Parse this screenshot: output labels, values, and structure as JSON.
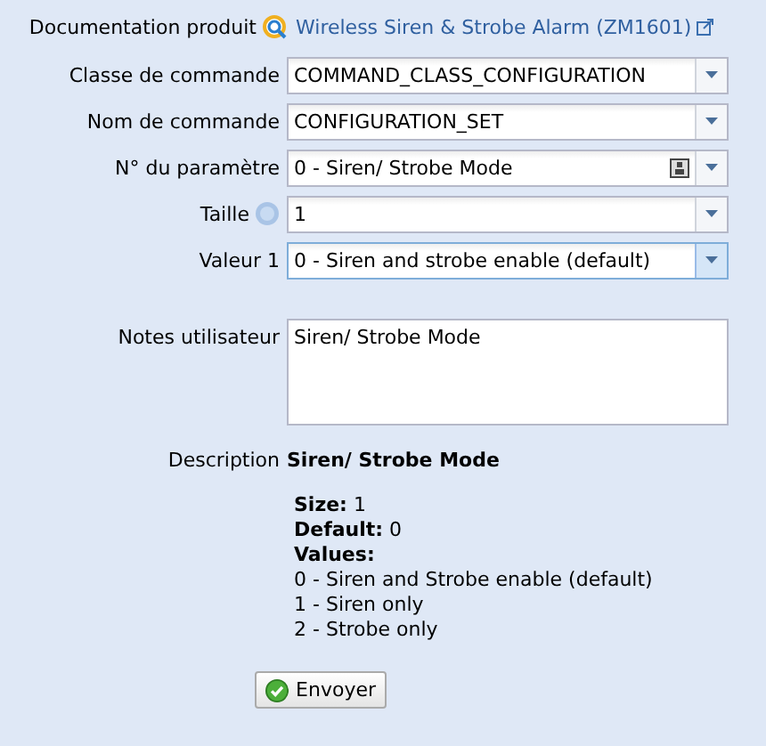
{
  "product_doc": {
    "label": "Documentation produit",
    "link": "Wireless Siren & Strobe Alarm (ZM1601)"
  },
  "fields": [
    {
      "label": "Classe de commande",
      "value": "COMMAND_CLASS_CONFIGURATION",
      "focused": false,
      "help": false,
      "picker": false
    },
    {
      "label": "Nom de commande",
      "value": "CONFIGURATION_SET",
      "focused": false,
      "help": false,
      "picker": false
    },
    {
      "label": "N° du paramètre",
      "value": "0 - Siren/ Strobe Mode",
      "focused": false,
      "help": false,
      "picker": true
    },
    {
      "label": "Taille",
      "value": "1",
      "focused": false,
      "help": true,
      "picker": false
    },
    {
      "label": "Valeur 1",
      "value": "0 - Siren and strobe enable (default)",
      "focused": true,
      "help": false,
      "picker": false
    }
  ],
  "notes": {
    "label": "Notes utilisateur",
    "value": "Siren/ Strobe Mode"
  },
  "description": {
    "label": "Description",
    "title": "Siren/ Strobe Mode",
    "lines": [
      {
        "text": "**Size:** 1",
        "kind": "line"
      },
      {
        "text": "**Default:** 0",
        "kind": "line"
      },
      {
        "text": "Values:",
        "kind": "heading"
      },
      {
        "text": "0 - Siren and Strobe enable (default)",
        "kind": "line"
      },
      {
        "text": "1 - Siren only",
        "kind": "line"
      },
      {
        "text": "2 - Strobe only",
        "kind": "line"
      }
    ]
  },
  "submit": {
    "label": "Envoyer"
  }
}
